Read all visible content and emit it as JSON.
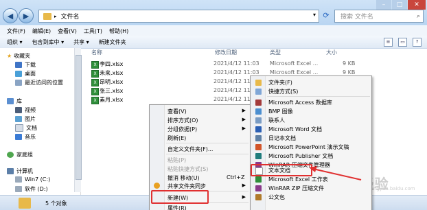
{
  "address": {
    "breadcrumb": "文件名",
    "search_placeholder": "搜索 文件名"
  },
  "menu": [
    "文件(F)",
    "编辑(E)",
    "查看(V)",
    "工具(T)",
    "帮助(H)"
  ],
  "toolbar": {
    "organize": "组织 ▾",
    "include": "包含到库中 ▾",
    "share": "共享 ▾",
    "new_folder": "新建文件夹"
  },
  "sidebar": {
    "favorites": "收藏夹",
    "download": "下载",
    "desktop": "桌面",
    "recent": "最近访问的位置",
    "library": "库",
    "video": "视频",
    "pictures": "图片",
    "documents": "文档",
    "music": "音乐",
    "homegroup": "家庭组",
    "computer": "计算机",
    "win7": "Win7 (C:)",
    "soft": "软件 (D:)"
  },
  "columns": {
    "name": "名称",
    "date": "修改日期",
    "type": "类型",
    "size": "大小"
  },
  "files": [
    {
      "name": "李四.xlsx",
      "date": "2021/4/12 11:03",
      "type": "Microsoft Excel ...",
      "size": "9 KB"
    },
    {
      "name": "未来.xlsx",
      "date": "2021/4/12 11:03",
      "type": "Microsoft Excel ...",
      "size": "9 KB"
    },
    {
      "name": "昂明.xlsx",
      "date": "2021/4/12 11",
      "type": "",
      "size": "KB"
    },
    {
      "name": "张三.xlsx",
      "date": "2021/4/12 11",
      "type": "",
      "size": "KB"
    },
    {
      "name": "素月.xlsx",
      "date": "2021/4/12 11",
      "type": "",
      "size": "KB"
    }
  ],
  "status": "5 个对象",
  "context_menu": {
    "view": "查看(V)",
    "sort": "排序方式(O)",
    "group": "分组依据(P)",
    "refresh": "刷新(E)",
    "customize": "自定义文件夹(F)...",
    "paste": "粘贴(P)",
    "paste_shortcut": "粘贴快捷方式(S)",
    "undo": "撤消 移动(U)",
    "undo_shortcut": "Ctrl+Z",
    "share_sync": "共享文件夹同步",
    "new": "新建(W)",
    "properties": "属性(R)"
  },
  "submenu": {
    "folder": "文件夹(F)",
    "shortcut": "快捷方式(S)",
    "access": "Microsoft Access 数据库",
    "bmp": "BMP 图像",
    "contact": "联系人",
    "word": "Microsoft Word 文档",
    "journal": "日记本文档",
    "ppt": "Microsoft PowerPoint 演示文稿",
    "publisher": "Microsoft Publisher 文档",
    "winrar": "WinRAR 压缩文件管理器",
    "text": "文本文档",
    "excel": "Microsoft Excel 工作表",
    "zip": "WinRAR ZIP 压缩文件",
    "briefcase": "公文包"
  },
  "watermark": "Bai 经验",
  "watermark_sub": "jingyan.baidu.com",
  "colors": {
    "title": "#c3dbf4",
    "highlight": "#e03030",
    "excel": "#2f8f3a"
  }
}
